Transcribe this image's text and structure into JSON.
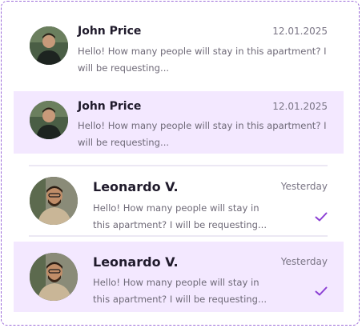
{
  "conversations": [
    {
      "name": "John Price",
      "date": "12.01.2025",
      "message": "Hello! How many people will stay in this apartment? I will be requesting...",
      "avatar_icon": "person-dark-jacket",
      "highlighted": false,
      "read": false
    },
    {
      "name": "John Price",
      "date": "12.01.2025",
      "message": "Hello! How many people will stay in this apartment? I will be requesting...",
      "avatar_icon": "person-dark-jacket",
      "highlighted": true,
      "read": false
    },
    {
      "name": "Leonardo V.",
      "date": "Yesterday",
      "message": "Hello! How many people will stay in this apartment? I will be requesting...",
      "avatar_icon": "person-beige-jacket",
      "highlighted": false,
      "read": true
    },
    {
      "name": "Leonardo V.",
      "date": "Yesterday",
      "message": "Hello! How many people will stay in this apartment? I will be requesting...",
      "avatar_icon": "person-beige-jacket",
      "highlighted": true,
      "read": true
    }
  ],
  "colors": {
    "highlight": "#f3e8ff",
    "accent": "#8b3fd4",
    "frame": "#9b6bd9"
  }
}
